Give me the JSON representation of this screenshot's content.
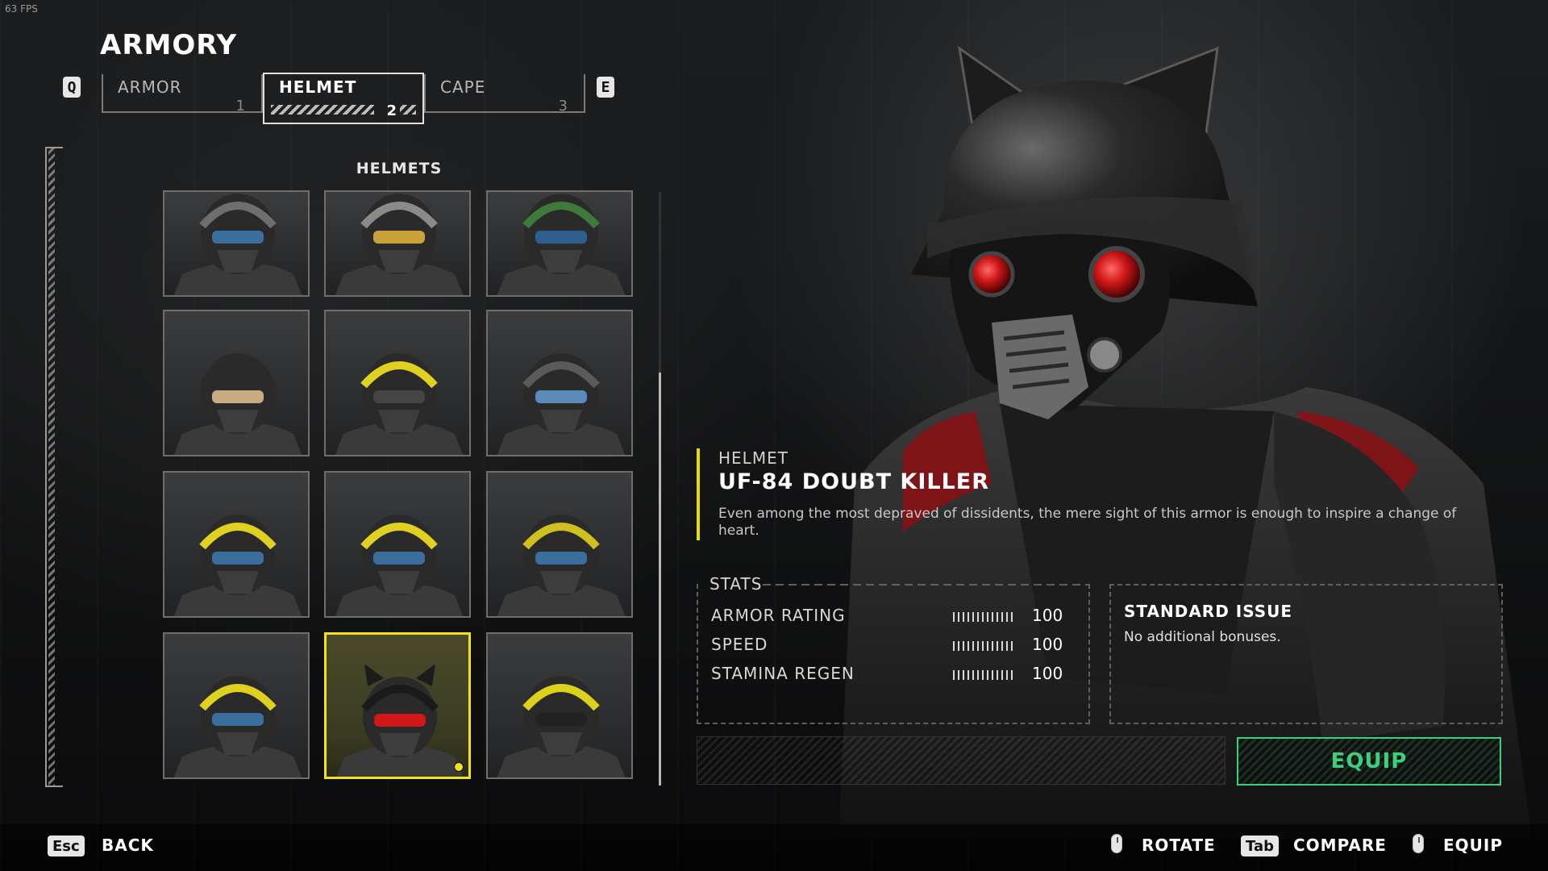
{
  "overlay": {
    "fps": "63 FPS"
  },
  "header": {
    "title": "ARMORY"
  },
  "tabs": {
    "prev_key": "Q",
    "next_key": "E",
    "items": [
      {
        "label": "ARMOR",
        "num": "1",
        "active": false
      },
      {
        "label": "HELMET",
        "num": "2",
        "active": true
      },
      {
        "label": "CAPE",
        "num": "3",
        "active": false
      }
    ]
  },
  "grid": {
    "title": "HELMETS",
    "selected_index": 10,
    "items": [
      {
        "name": "helmet-black-striped",
        "accent": "#6e6e6e",
        "visor": "#3b6e9e"
      },
      {
        "name": "helmet-gray-gold-visor",
        "accent": "#8a8a8a",
        "visor": "#c9a23a"
      },
      {
        "name": "helmet-green",
        "accent": "#3f7a3a",
        "visor": "#2f5f8f"
      },
      {
        "name": "helmet-hooded",
        "accent": "#2b2b2b",
        "visor": "#c8ad82"
      },
      {
        "name": "helmet-yellow-crest",
        "accent": "#e0d020",
        "visor": "#444"
      },
      {
        "name": "helmet-white-faceplate",
        "accent": "#5a5a5a",
        "visor": "#5b8cb8"
      },
      {
        "name": "helmet-yellow-stripe-a",
        "accent": "#e0d020",
        "visor": "#3b6e9e"
      },
      {
        "name": "helmet-yellow-stripe-b",
        "accent": "#e0d020",
        "visor": "#3b6e9e"
      },
      {
        "name": "helmet-yellow-side",
        "accent": "#cfc020",
        "visor": "#3b6e9e"
      },
      {
        "name": "helmet-yellow-stripe-c",
        "accent": "#e0d020",
        "visor": "#3b6e9e"
      },
      {
        "name": "helmet-uf84-doubt-killer",
        "accent": "#1a1a1a",
        "visor": "#d01818"
      },
      {
        "name": "helmet-knight-yellow",
        "accent": "#dcd21c",
        "visor": "#222"
      }
    ]
  },
  "item": {
    "kicker": "HELMET",
    "name": "UF-84 DOUBT KILLER",
    "description": "Even among the most depraved of dissidents, the mere sight of this armor is enough to inspire a change of heart."
  },
  "stats": {
    "title": "STATS",
    "rows": [
      {
        "name": "ARMOR RATING",
        "value": "100"
      },
      {
        "name": "SPEED",
        "value": "100"
      },
      {
        "name": "STAMINA REGEN",
        "value": "100"
      }
    ]
  },
  "passive": {
    "title": "STANDARD ISSUE",
    "description": "No additional bonuses."
  },
  "actions": {
    "equip": "EQUIP"
  },
  "footer": {
    "back_key": "Esc",
    "back": "BACK",
    "rotate": "ROTATE",
    "compare_key": "Tab",
    "compare": "COMPARE",
    "equip": "EQUIP"
  },
  "colors": {
    "accent_yellow": "#f2e21a",
    "equip_green": "#3ecf7a",
    "visor_red": "#d01818"
  }
}
